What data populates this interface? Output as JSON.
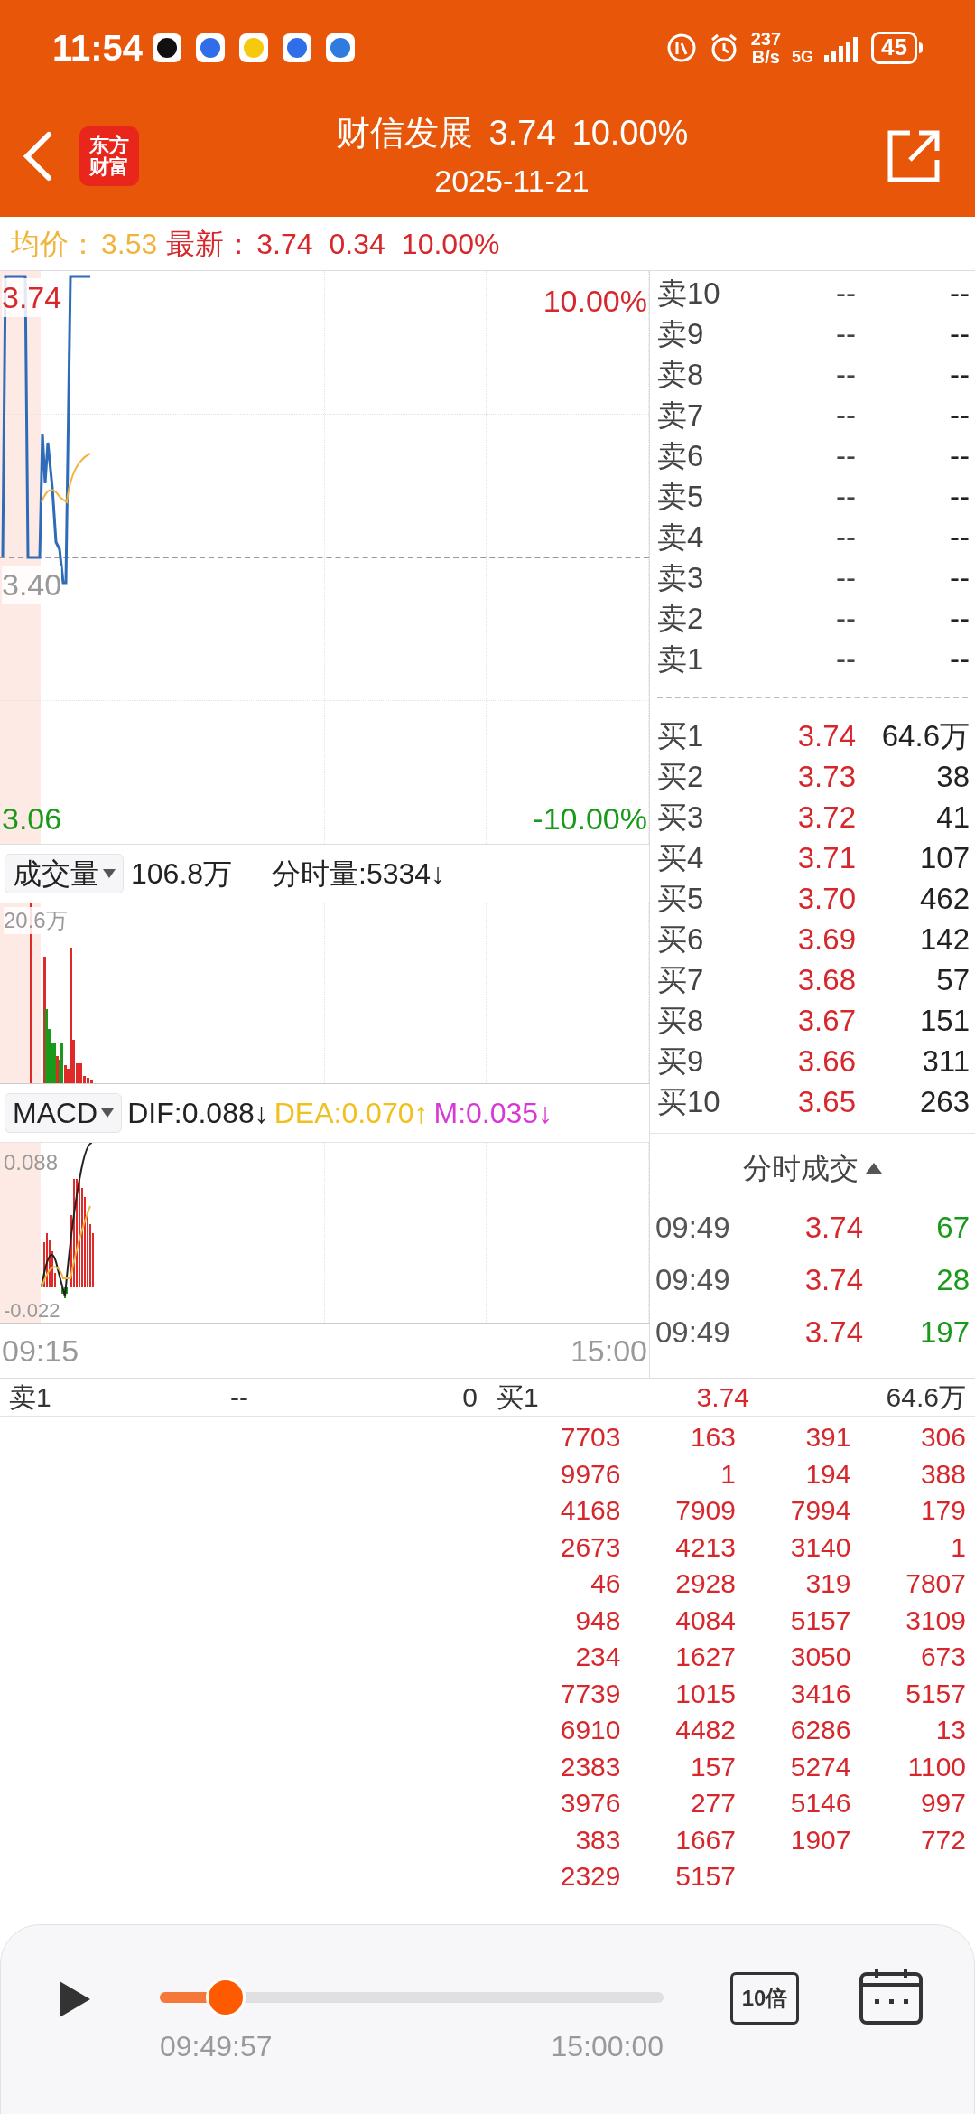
{
  "status_bar": {
    "time": "11:54",
    "network_speed": "237",
    "network_unit": "B/s",
    "network_type": "5G",
    "battery": "45"
  },
  "header": {
    "logo_line1": "东方",
    "logo_line2": "财富",
    "title": "财信发展",
    "price": "3.74",
    "change_pct": "10.00%",
    "date": "2025-11-21"
  },
  "info_bar": {
    "avg_label": "均价：",
    "avg_value": "3.53",
    "latest_label": "最新：",
    "latest_price": "3.74",
    "change": "0.34",
    "change_pct": "10.00%"
  },
  "price_chart": {
    "top_price": "3.74",
    "mid_price": "3.40",
    "bottom_price": "3.06",
    "top_pct": "10.00%",
    "bottom_pct": "-10.00%"
  },
  "volume_panel": {
    "selector": "成交量",
    "total": "106.8万",
    "minute_volume": "分时量:5334↓",
    "max_label": "20.6万"
  },
  "macd_panel": {
    "selector": "MACD",
    "dif": "DIF:0.088↓",
    "dea": "DEA:0.070↑",
    "m": "M:0.035↓",
    "max_label": "0.088",
    "min_label": "-0.022"
  },
  "time_axis": {
    "start": "09:15",
    "end": "15:00"
  },
  "order_book": {
    "asks": [
      {
        "label": "卖10",
        "price": "--",
        "volume": "--"
      },
      {
        "label": "卖9",
        "price": "--",
        "volume": "--"
      },
      {
        "label": "卖8",
        "price": "--",
        "volume": "--"
      },
      {
        "label": "卖7",
        "price": "--",
        "volume": "--"
      },
      {
        "label": "卖6",
        "price": "--",
        "volume": "--"
      },
      {
        "label": "卖5",
        "price": "--",
        "volume": "--"
      },
      {
        "label": "卖4",
        "price": "--",
        "volume": "--"
      },
      {
        "label": "卖3",
        "price": "--",
        "volume": "--"
      },
      {
        "label": "卖2",
        "price": "--",
        "volume": "--"
      },
      {
        "label": "卖1",
        "price": "--",
        "volume": "--"
      }
    ],
    "bids": [
      {
        "label": "买1",
        "price": "3.74",
        "volume": "64.6万"
      },
      {
        "label": "买2",
        "price": "3.73",
        "volume": "38"
      },
      {
        "label": "买3",
        "price": "3.72",
        "volume": "41"
      },
      {
        "label": "买4",
        "price": "3.71",
        "volume": "107"
      },
      {
        "label": "买5",
        "price": "3.70",
        "volume": "462"
      },
      {
        "label": "买6",
        "price": "3.69",
        "volume": "142"
      },
      {
        "label": "买7",
        "price": "3.68",
        "volume": "57"
      },
      {
        "label": "买8",
        "price": "3.67",
        "volume": "151"
      },
      {
        "label": "买9",
        "price": "3.66",
        "volume": "311"
      },
      {
        "label": "买10",
        "price": "3.65",
        "volume": "263"
      }
    ]
  },
  "trades": {
    "title": "分时成交",
    "rows": [
      {
        "time": "09:49",
        "price": "3.74",
        "volume": "67",
        "color": "#1a9a1a"
      },
      {
        "time": "09:49",
        "price": "3.74",
        "volume": "28",
        "color": "#1a9a1a"
      },
      {
        "time": "09:49",
        "price": "3.74",
        "volume": "197",
        "color": "#1a9a1a"
      }
    ]
  },
  "bottom_table": {
    "ask": {
      "label": "卖1",
      "price": "--",
      "volume": "0"
    },
    "bid": {
      "label": "买1",
      "price": "3.74",
      "volume": "64.6万"
    },
    "bid_orders": [
      [
        "7703",
        "163",
        "391",
        "306"
      ],
      [
        "9976",
        "1",
        "194",
        "388"
      ],
      [
        "4168",
        "7909",
        "7994",
        "179"
      ],
      [
        "2673",
        "4213",
        "3140",
        "1"
      ],
      [
        "46",
        "2928",
        "319",
        "7807"
      ],
      [
        "948",
        "4084",
        "5157",
        "3109"
      ],
      [
        "234",
        "1627",
        "3050",
        "673"
      ],
      [
        "7739",
        "1015",
        "3416",
        "5157"
      ],
      [
        "6910",
        "4482",
        "6286",
        "13"
      ],
      [
        "2383",
        "157",
        "5274",
        "1100"
      ],
      [
        "3976",
        "277",
        "5146",
        "997"
      ],
      [
        "383",
        "1667",
        "1907",
        "772"
      ],
      [
        "2329",
        "5157"
      ]
    ]
  },
  "player": {
    "playing": false,
    "level": 0.13,
    "current_time": "09:49:57",
    "end_time": "15:00:00",
    "speed": "10倍"
  }
}
